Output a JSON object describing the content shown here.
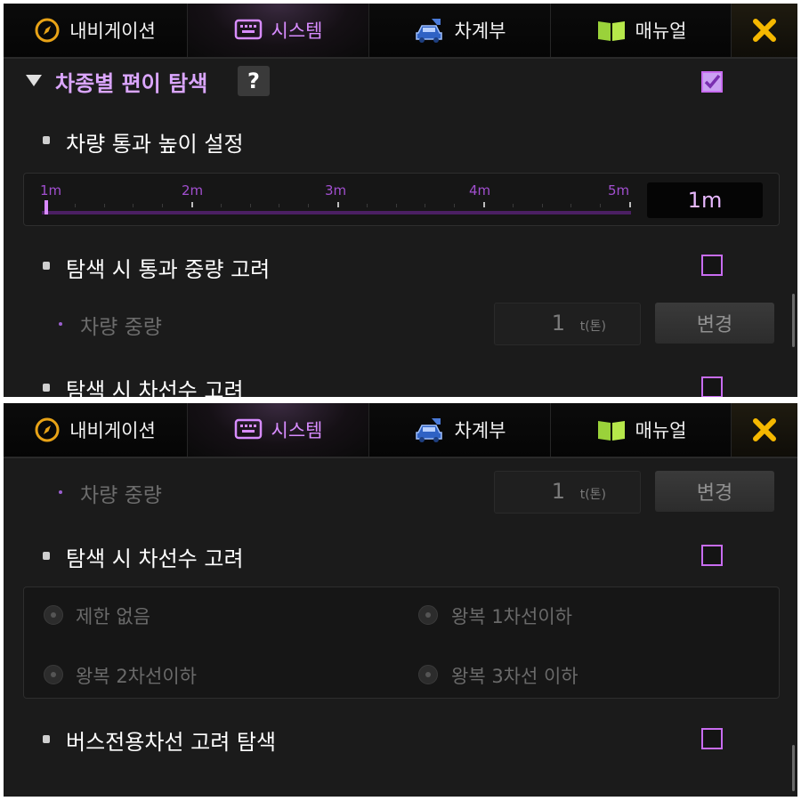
{
  "nav": {
    "tabs": [
      {
        "label": "내비게이션",
        "icon": "compass-icon"
      },
      {
        "label": "시스템",
        "icon": "keyboard-icon",
        "active": true
      },
      {
        "label": "차계부",
        "icon": "car-icon"
      },
      {
        "label": "매뉴얼",
        "icon": "book-icon"
      }
    ],
    "close_icon": "close-icon"
  },
  "panel_a": {
    "section": {
      "title": "차종별 편이 탐색",
      "help": "?",
      "checked": true
    },
    "height_setting": {
      "label": "차량 통과 높이 설정",
      "ticks": [
        "1m",
        "2m",
        "3m",
        "4m",
        "5m"
      ],
      "value": "1m"
    },
    "weight_setting": {
      "label": "탐색 시 통과 중량 고려",
      "checked": false
    },
    "vehicle_weight": {
      "label": "차량 중량",
      "value": "1",
      "unit": "t(톤)",
      "button": "변경"
    },
    "lane_setting": {
      "label": "탐색 시 차선수 고려",
      "checked": false
    }
  },
  "panel_b": {
    "vehicle_weight": {
      "label": "차량 중량",
      "value": "1",
      "unit": "t(톤)",
      "button": "변경"
    },
    "lane_setting": {
      "label": "탐색 시 차선수 고려",
      "checked": false
    },
    "lane_options": [
      "제한 없음",
      "왕복 1차선이하",
      "왕복 2차선이하",
      "왕복 3차선 이하"
    ],
    "bus_lane": {
      "label": "버스전용차선 고려 탐색",
      "checked": false
    }
  },
  "colors": {
    "accent": "#d88cff",
    "checkbox_border": "#c86cf0",
    "background": "#1b1b1b",
    "close": "#f5b800"
  }
}
